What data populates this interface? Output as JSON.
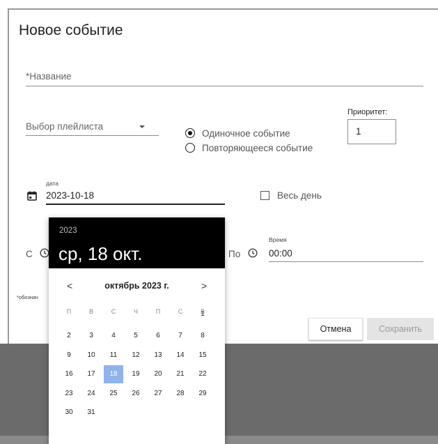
{
  "dialog": {
    "title": "Новое событие",
    "name_placeholder": "*Название",
    "playlist_placeholder": "Выбор плейлиста",
    "radio_single": "Одиночное событие",
    "radio_repeat": "Повторяющееся событие",
    "priority_label": "Приоритет:",
    "priority_value": "1",
    "date_label": "дата",
    "date_value": "2023-10-18",
    "all_day_label": "Весь день",
    "from_label": "С",
    "to_label": "По",
    "time_label": "Время",
    "time_to_value": "00:00",
    "footnote": "*обознач",
    "cancel_label": "Отмена",
    "save_label": "Сохранить"
  },
  "calendar": {
    "year": "2023",
    "selected_date_text": "ср, 18 окт.",
    "month_title": "октябрь 2023 г.",
    "prev_label": "<",
    "next_label": ">",
    "weekdays": [
      "П",
      "В",
      "С",
      "Ч",
      "П",
      "С",
      "В"
    ],
    "days": [
      [
        "",
        "",
        "",
        "",
        "",
        "",
        "1"
      ],
      [
        "2",
        "3",
        "4",
        "5",
        "6",
        "7",
        "8"
      ],
      [
        "9",
        "10",
        "11",
        "12",
        "13",
        "14",
        "15"
      ],
      [
        "16",
        "17",
        "18",
        "19",
        "20",
        "21",
        "22"
      ],
      [
        "23",
        "24",
        "25",
        "26",
        "27",
        "28",
        "29"
      ],
      [
        "30",
        "31",
        "",
        "",
        "",
        "",
        ""
      ]
    ],
    "selected_day": "18",
    "selected_color": "#8fb3ec"
  }
}
